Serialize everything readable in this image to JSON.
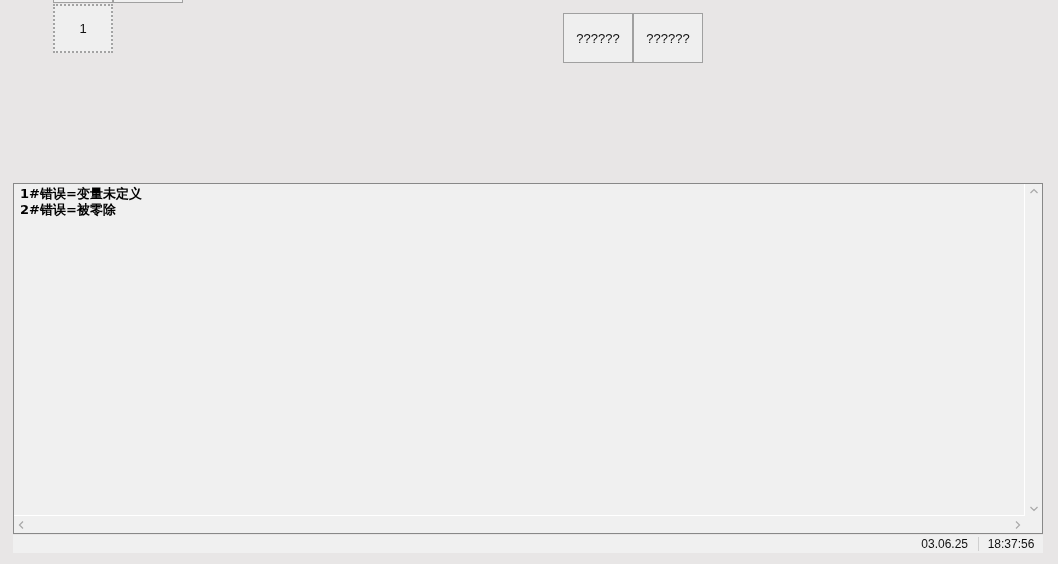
{
  "buttons": [
    {
      "label": "1",
      "focused": true
    }
  ],
  "action_buttons": [
    {
      "label": "??????",
      "focused": false
    },
    {
      "label": "??????",
      "focused": false
    }
  ],
  "log": {
    "lines": [
      "1#错误=变量未定义",
      "2#错误=被零除"
    ]
  },
  "status_bar": {
    "date": "03.06.25",
    "time": "18:37:56"
  }
}
